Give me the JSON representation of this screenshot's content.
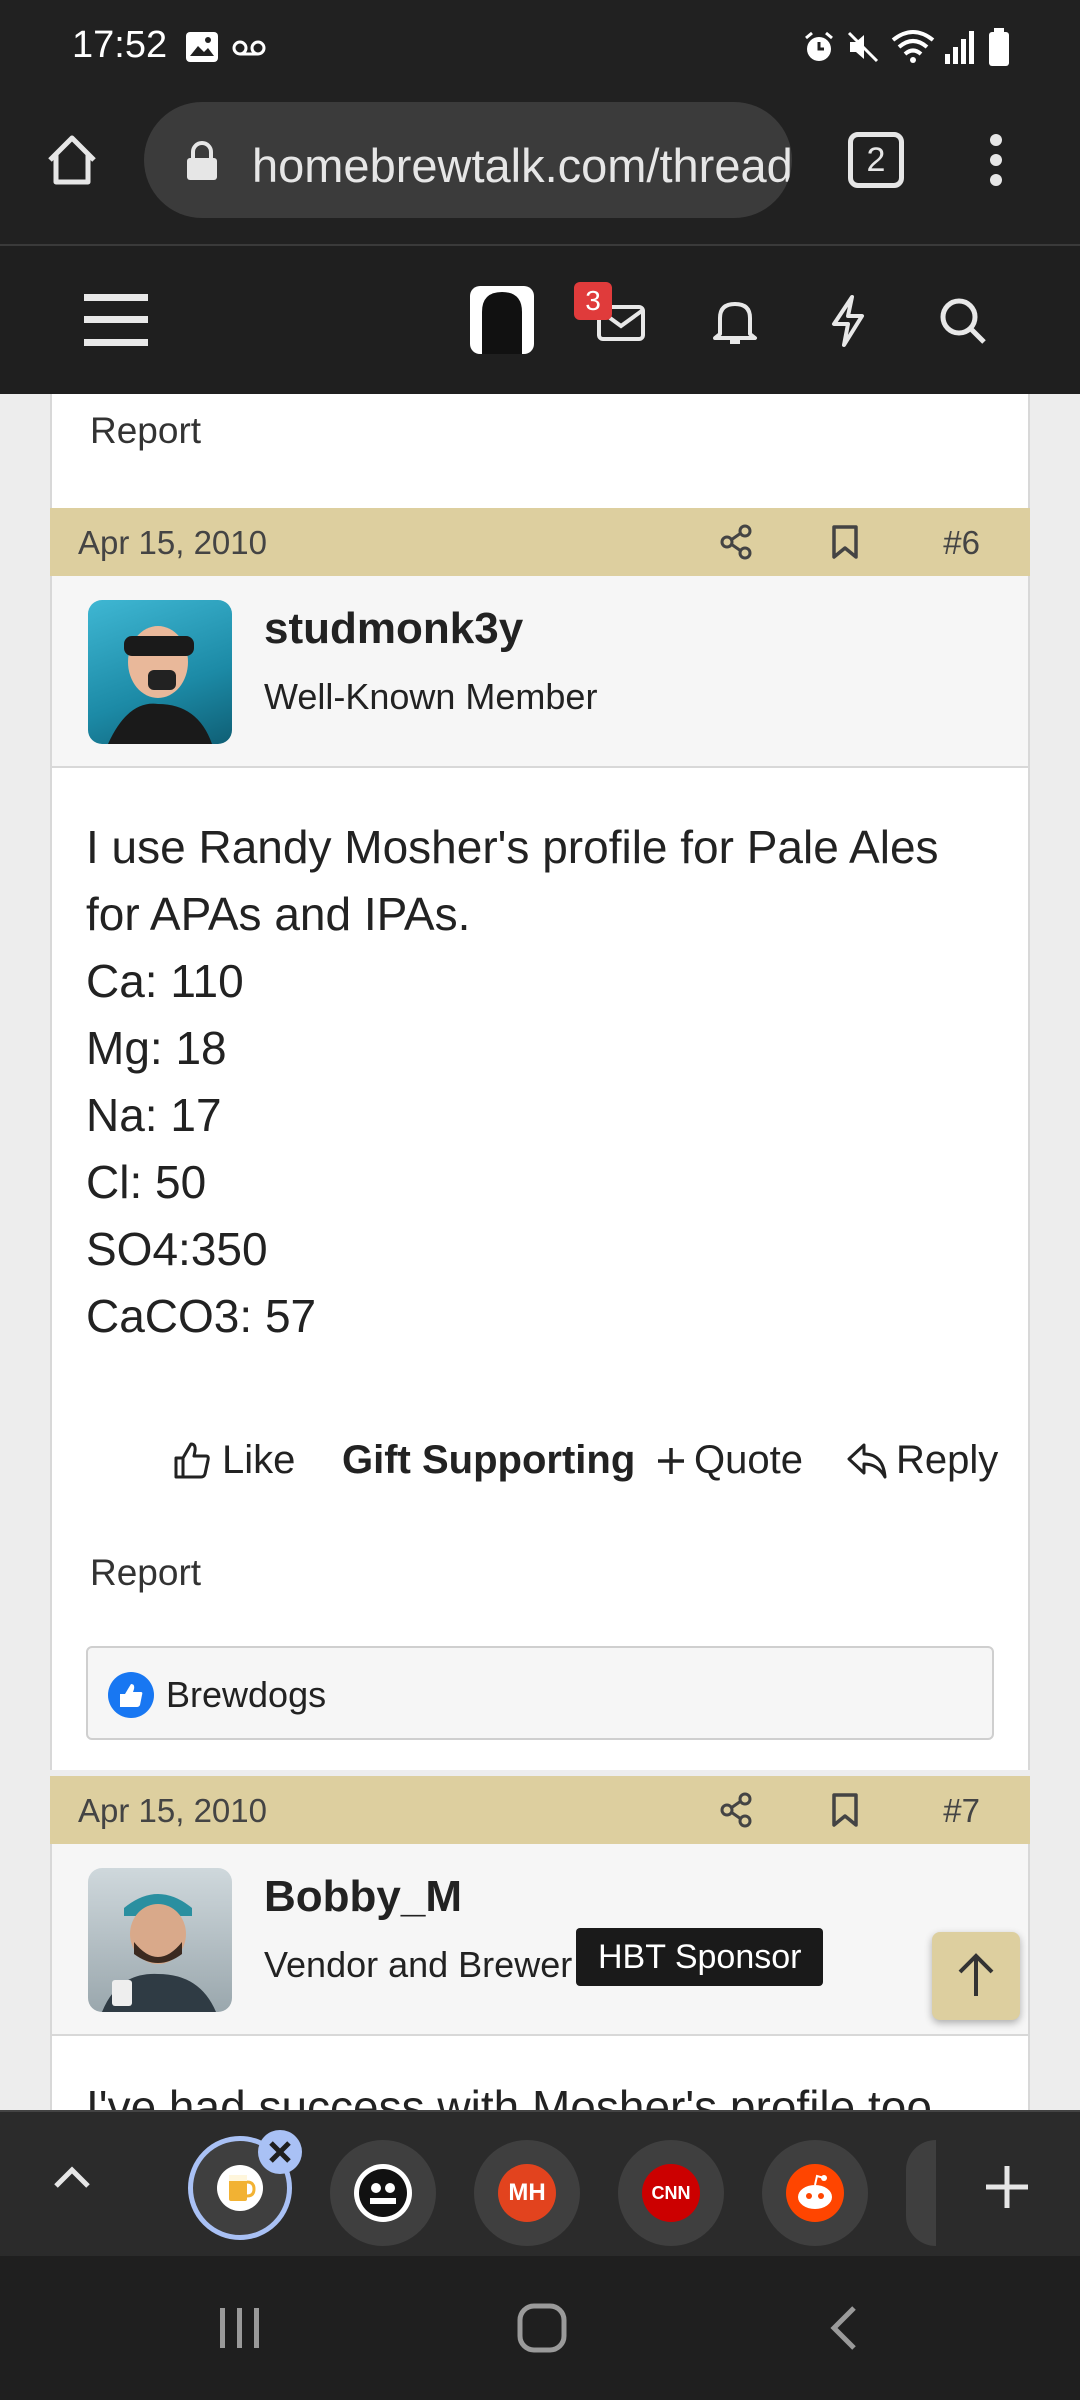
{
  "status_bar": {
    "time": "17:52"
  },
  "browser": {
    "url": "homebrewtalk.com/threads",
    "tab_count": "2"
  },
  "site_header": {
    "inbox_badge": "3"
  },
  "prev_post": {
    "report_label": "Report"
  },
  "post6": {
    "date": "Apr 15, 2010",
    "number": "#6",
    "username": "studmonk3y",
    "user_title": "Well-Known Member",
    "body_lines": [
      "I use Randy Mosher's profile for Pale Ales",
      "for APAs and IPAs.",
      "Ca: 110",
      "Mg: 18",
      "Na: 17",
      "Cl: 50",
      "SO4:350",
      "CaCO3: 57"
    ],
    "actions": {
      "like": "Like",
      "gift": "Gift Supporting",
      "quote": "Quote",
      "reply": "Reply",
      "report": "Report"
    },
    "reactions": {
      "user": "Brewdogs"
    }
  },
  "post7": {
    "date": "Apr 15, 2010",
    "number": "#7",
    "username": "Bobby_M",
    "user_title": "Vendor and Brewer",
    "badge": "HBT Sponsor",
    "body_preview": "I've had success with Mosher's profile too"
  },
  "tabs": {
    "mh_label": "MH",
    "cnn_label": "CNN"
  },
  "colors": {
    "post_header": "#ddcf9f",
    "badge_red": "#e03b3b",
    "like_blue": "#1877f2"
  }
}
